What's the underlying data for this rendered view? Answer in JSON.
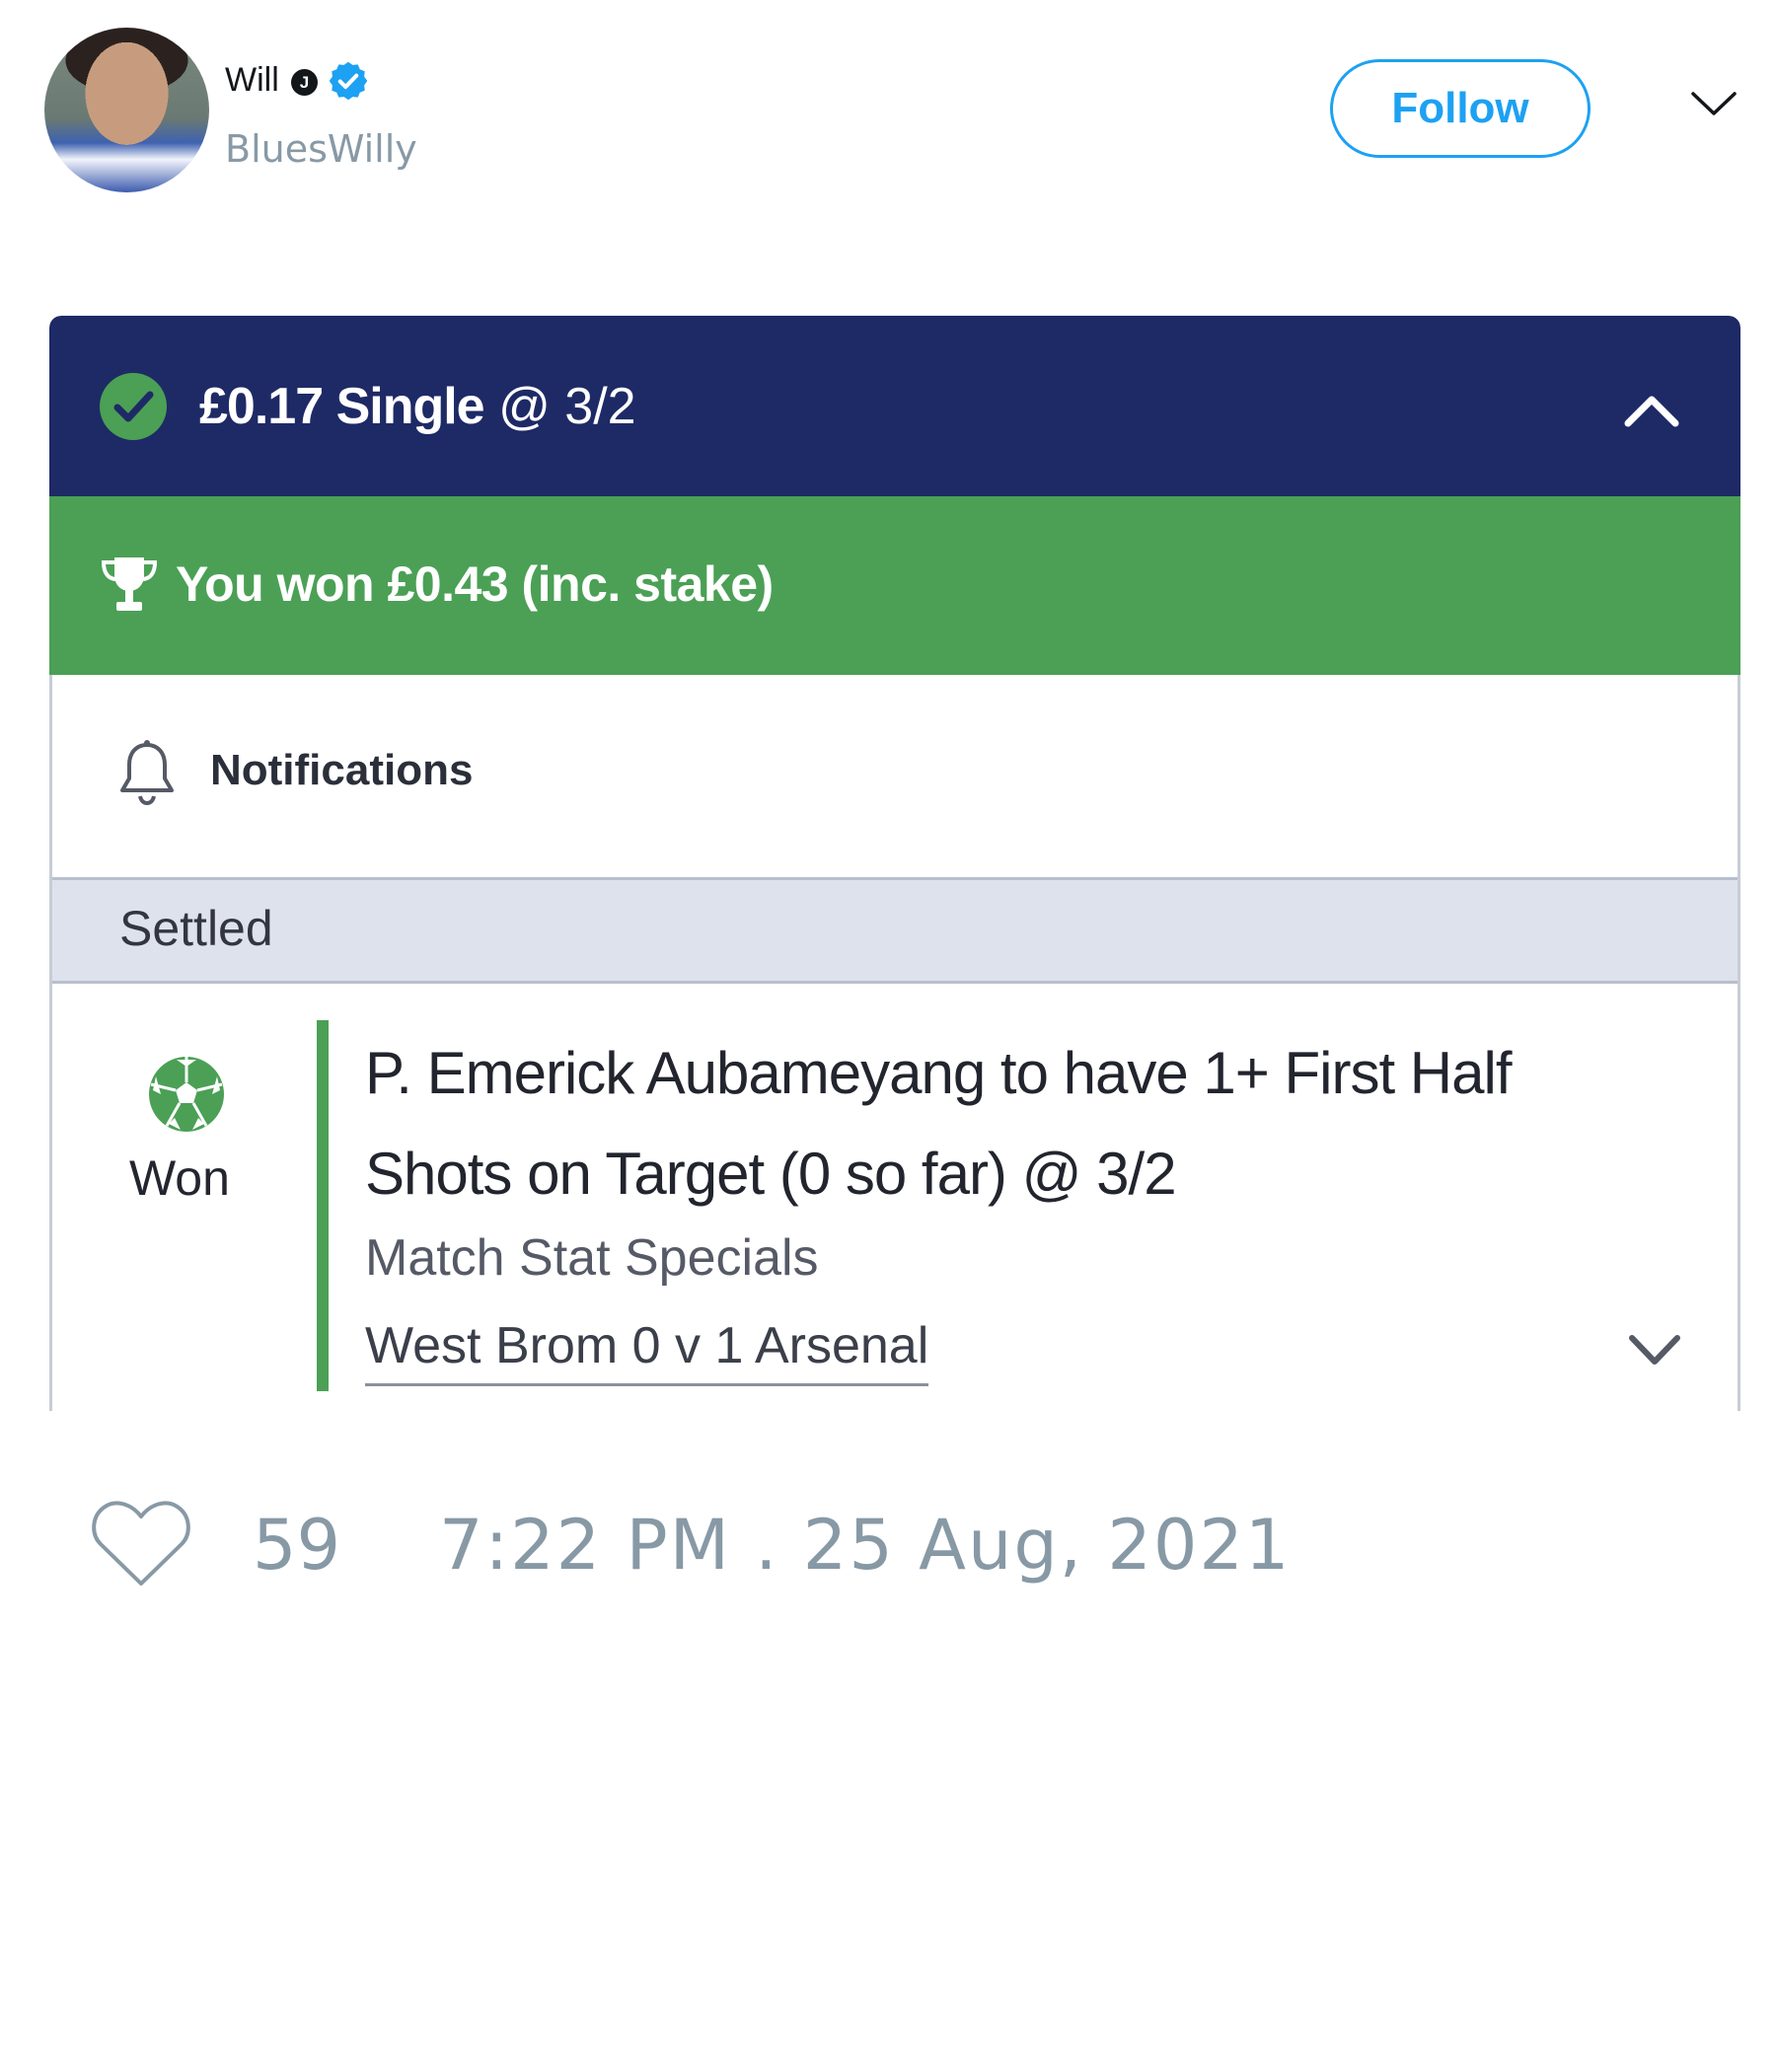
{
  "tweet": {
    "display_name": "Will",
    "name_badge_letter": "J",
    "handle": "BluesWilly",
    "follow_label": "Follow",
    "like_count": "59",
    "timestamp": "7:22 PM . 25 Aug, 2021"
  },
  "bet": {
    "stake_type": "£0.17 Single",
    "odds": "@ 3/2",
    "result_banner": "You won £0.43 (inc. stake)",
    "notifications_label": "Notifications",
    "section_label": "Settled",
    "selection": {
      "status": "Won",
      "name": "P. Emerick Aubameyang to have 1+ First Half Shots on Target (0 so far) @ 3/2",
      "market": "Match Stat Specials",
      "event": "West Brom 0 v 1 Arsenal"
    }
  },
  "colors": {
    "header_navy": "#1e2a66",
    "win_green": "#4ba055",
    "twitter_blue": "#1da1f2",
    "muted_grey": "#8899a6"
  },
  "icons": [
    "verified-icon",
    "chevron-down-icon",
    "check-circle-icon",
    "chevron-up-icon",
    "trophy-icon",
    "bell-icon",
    "football-icon",
    "heart-icon"
  ]
}
